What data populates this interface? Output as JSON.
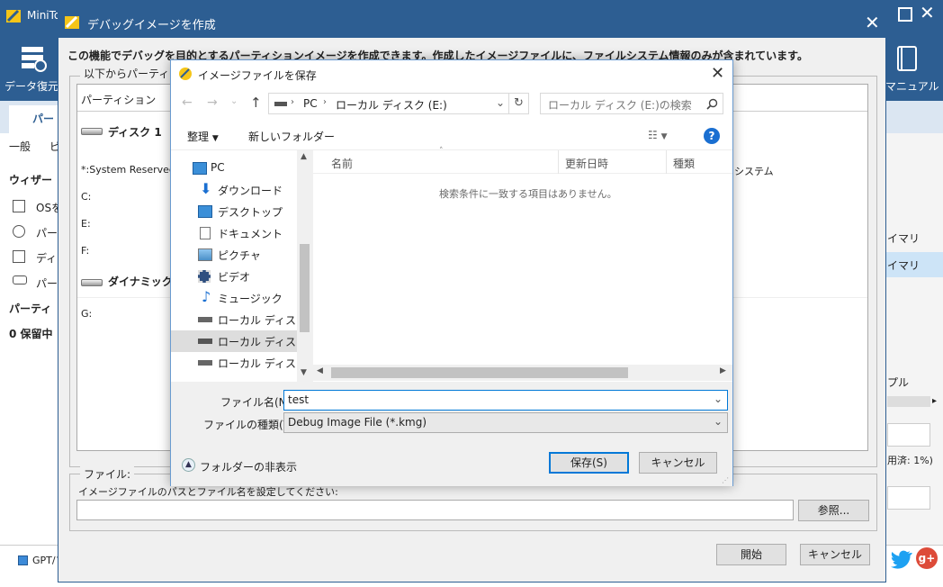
{
  "app": {
    "title": "MiniTool",
    "recover_label": "データ復元",
    "manual_label": "マニュアル",
    "tab_label": "パー",
    "sub_items": [
      "一般",
      "ビ"
    ],
    "wizard_title": "ウィザー",
    "wizard_items": [
      "OSを",
      "パー",
      "ディ",
      "パー"
    ],
    "partition_title": "パーティ",
    "pending": "0 保留中",
    "right_items": [
      "イマリ",
      "イマリ",
      "プル",
      "用済: 1%)"
    ],
    "legend": "GPT/プ",
    "colors": {
      "titlebar": "#2d5e92",
      "accent": "#0078d7"
    }
  },
  "debug_dialog": {
    "title": "デバッグイメージを作成",
    "description": "この機能でデバッグを目的とするパーティションイメージを作成できます。作成したイメージファイルに、ファイルシステム情報のみが含まれています。",
    "group_label": "以下からパーティ",
    "list_header": "パーティション",
    "disk1_label": "ディスク 1",
    "partitions_disk1": [
      "*:System Reserved",
      "C:",
      "E:",
      "F:"
    ],
    "dynamic_label": "ダイナミック",
    "partitions_dynamic": [
      "G:"
    ],
    "right_col": "システム",
    "file_group_label": "ファイル:",
    "file_hint": "イメージファイルのパスとファイル名を設定してください:",
    "path_value": "",
    "browse_label": "参照...",
    "start_label": "開始",
    "cancel_label": "キャンセル"
  },
  "save_dialog": {
    "title": "イメージファイルを保存",
    "breadcrumb": [
      "PC",
      "ローカル ディスク (E:)"
    ],
    "search_placeholder": "ローカル ディスク (E:)の検索",
    "organize_label": "整理",
    "new_folder_label": "新しいフォルダー",
    "tree_items": [
      {
        "label": "PC",
        "icon": "pc-icon"
      },
      {
        "label": "ダウンロード",
        "icon": "download-icon"
      },
      {
        "label": "デスクトップ",
        "icon": "desktop-icon"
      },
      {
        "label": "ドキュメント",
        "icon": "document-icon"
      },
      {
        "label": "ピクチャ",
        "icon": "picture-icon"
      },
      {
        "label": "ビデオ",
        "icon": "video-icon"
      },
      {
        "label": "ミュージック",
        "icon": "music-icon"
      },
      {
        "label": "ローカル ディスク (C",
        "icon": "drive-icon"
      },
      {
        "label": "ローカル ディスク (E",
        "icon": "drive-icon"
      },
      {
        "label": "ローカル ディスク (F",
        "icon": "drive-icon"
      }
    ],
    "columns": [
      "名前",
      "更新日時",
      "種類"
    ],
    "empty_message": "検索条件に一致する項目はありません。",
    "filename_label": "ファイル名(N):",
    "filename_value": "test",
    "filetype_label": "ファイルの種類(T):",
    "filetype_value": "Debug Image File (*.kmg)",
    "hide_folders_label": "フォルダーの非表示",
    "save_label": "保存(S)",
    "cancel_label": "キャンセル"
  }
}
